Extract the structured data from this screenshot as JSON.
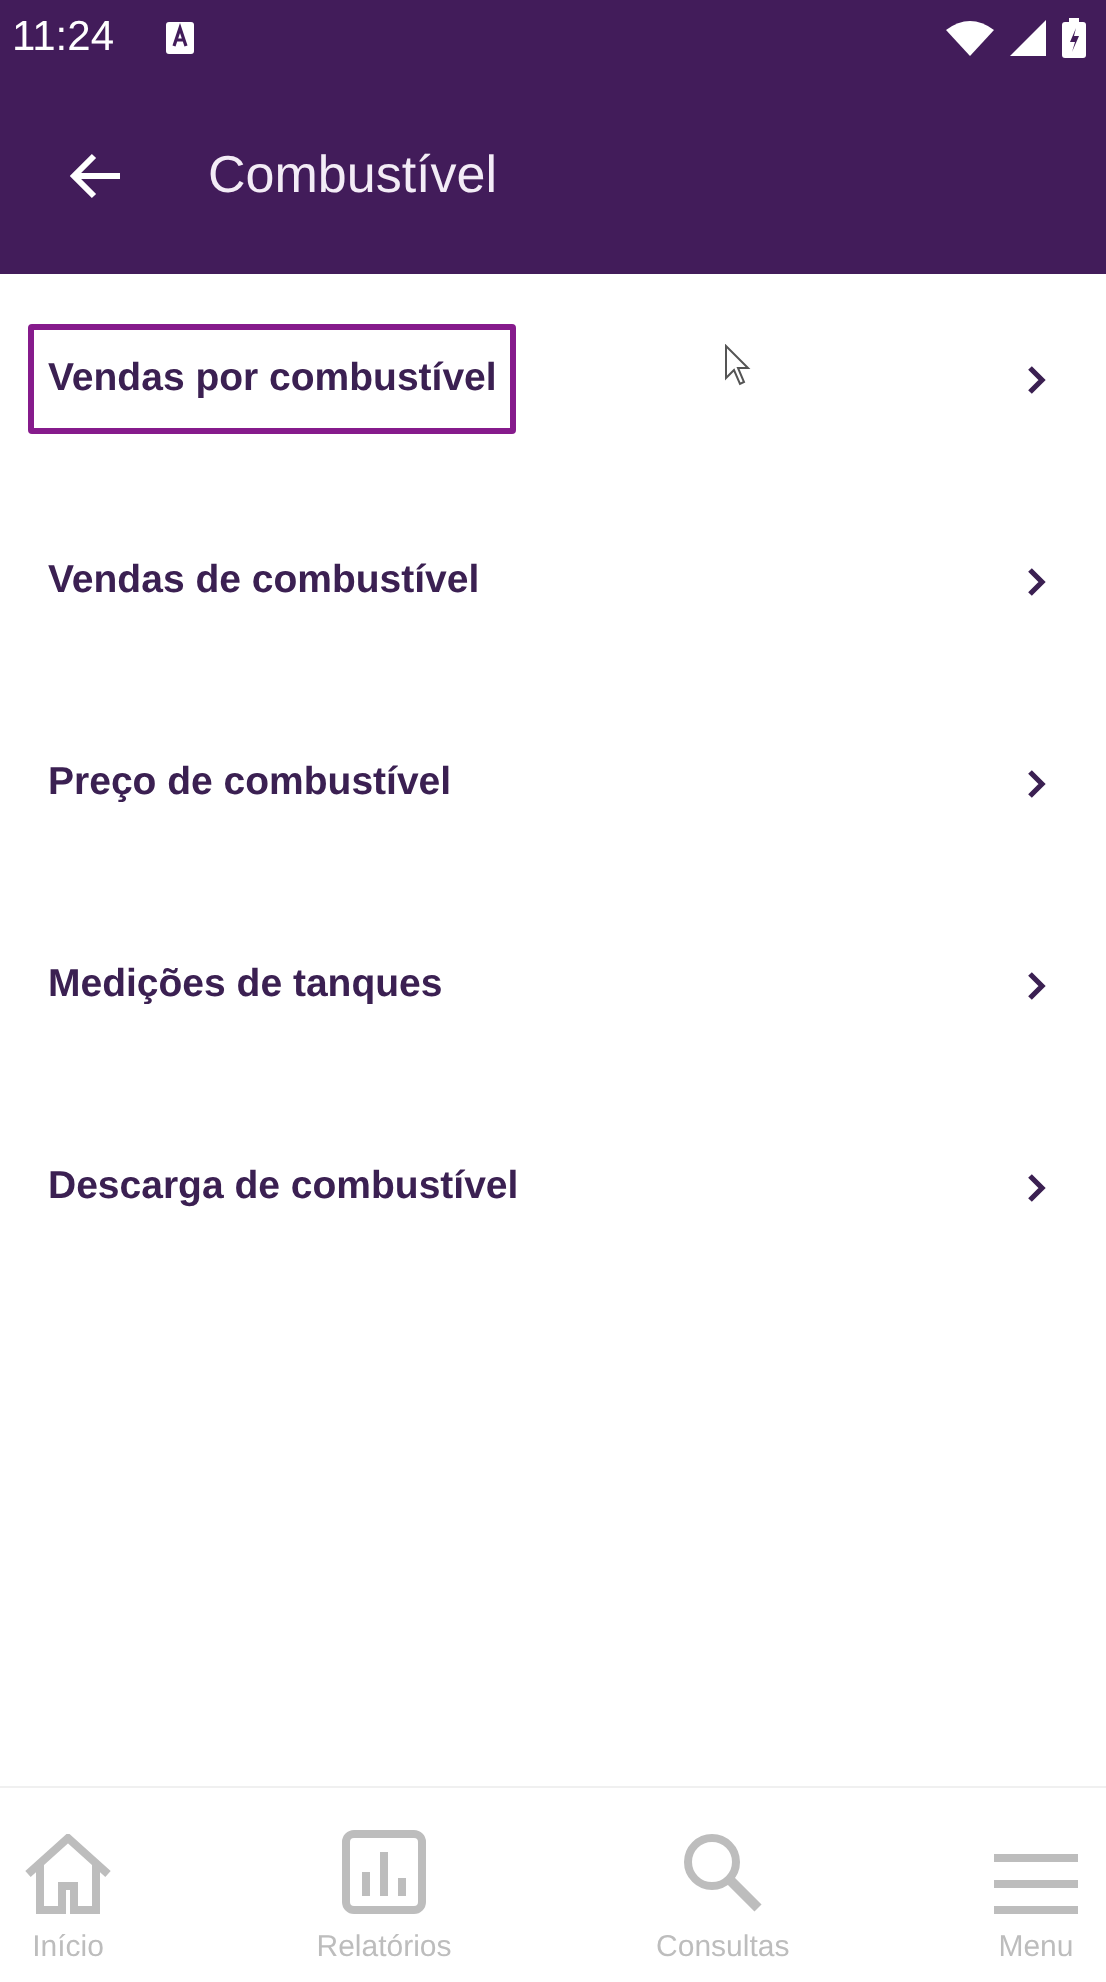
{
  "status_bar": {
    "time": "11:24"
  },
  "app_bar": {
    "title": "Combustível"
  },
  "items": [
    {
      "label": "Vendas por combustível",
      "highlighted": true
    },
    {
      "label": "Vendas de combustível",
      "highlighted": false
    },
    {
      "label": "Preço de combustível",
      "highlighted": false
    },
    {
      "label": "Medições de tanques",
      "highlighted": false
    },
    {
      "label": "Descarga de combustível",
      "highlighted": false
    }
  ],
  "bottom_nav": [
    {
      "kind": "home",
      "label": "Início"
    },
    {
      "kind": "reports",
      "label": "Relatórios"
    },
    {
      "kind": "search",
      "label": "Consultas"
    },
    {
      "kind": "menu",
      "label": "Menu"
    }
  ]
}
